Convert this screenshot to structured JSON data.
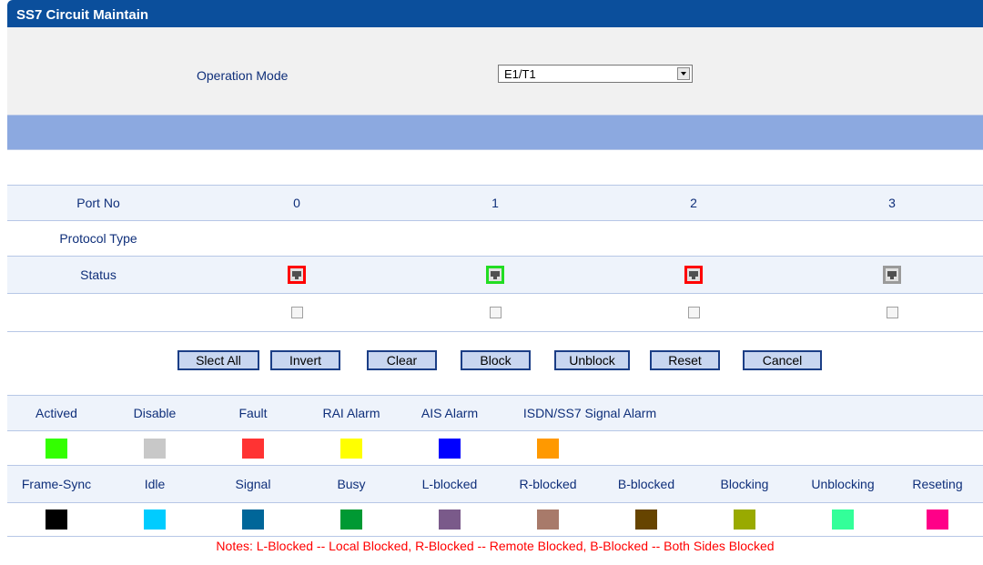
{
  "title": "SS7 Circuit Maintain",
  "operation": {
    "label": "Operation Mode",
    "value": "E1/T1"
  },
  "table": {
    "port_label": "Port No",
    "protocol_label": "Protocol Type",
    "status_label": "Status",
    "ports": [
      "0",
      "1",
      "2",
      "3"
    ],
    "status_colors": [
      "#ff0000",
      "#22dd22",
      "#ff0000",
      "#9a9a9a"
    ]
  },
  "buttons": {
    "select_all": "Slect All",
    "invert": "Invert",
    "clear": "Clear",
    "block": "Block",
    "unblock": "Unblock",
    "reset": "Reset",
    "cancel": "Cancel"
  },
  "legend": {
    "alarms": [
      {
        "label": "Actived",
        "color": "#33ff00"
      },
      {
        "label": "Disable",
        "color": "#c8c8c8"
      },
      {
        "label": "Fault",
        "color": "#ff3333"
      },
      {
        "label": "RAI Alarm",
        "color": "#ffff00"
      },
      {
        "label": "AIS Alarm",
        "color": "#0000ff"
      },
      {
        "label": "ISDN/SS7 Signal Alarm",
        "color": "#ff9900"
      }
    ],
    "states": [
      {
        "label": "Frame-Sync",
        "color": "#000000"
      },
      {
        "label": "Idle",
        "color": "#00ccff"
      },
      {
        "label": "Signal",
        "color": "#006699"
      },
      {
        "label": "Busy",
        "color": "#009933"
      },
      {
        "label": "L-blocked",
        "color": "#7a5a8a"
      },
      {
        "label": "R-blocked",
        "color": "#a87a6a"
      },
      {
        "label": "B-blocked",
        "color": "#664400"
      },
      {
        "label": "Blocking",
        "color": "#99aa00"
      },
      {
        "label": "Unblocking",
        "color": "#33ff99"
      },
      {
        "label": "Reseting",
        "color": "#ff0088"
      }
    ]
  },
  "notes": "Notes: L-Blocked -- Local Blocked, R-Blocked -- Remote Blocked, B-Blocked -- Both Sides Blocked"
}
